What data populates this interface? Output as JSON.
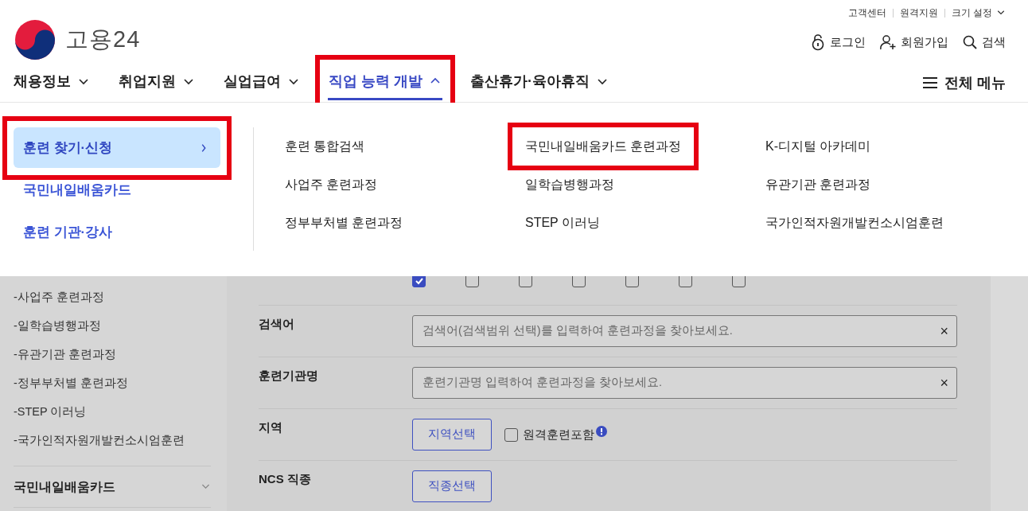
{
  "utility_links": [
    {
      "label": "고객센터",
      "kind": "link"
    },
    {
      "label": "원격지원",
      "kind": "link"
    },
    {
      "label": "크기 설정",
      "kind": "dropdown"
    }
  ],
  "logo": {
    "text": "고용24"
  },
  "account_links": [
    {
      "label": "로그인",
      "kind": "login"
    },
    {
      "label": "회원가입",
      "kind": "signup"
    },
    {
      "label": "검색",
      "kind": "search"
    }
  ],
  "nav": {
    "items": [
      {
        "label": "채용정보",
        "selected": false,
        "highlighted": false
      },
      {
        "label": "취업지원",
        "selected": false,
        "highlighted": false
      },
      {
        "label": "실업급여",
        "selected": false,
        "highlighted": false
      },
      {
        "label": "직업 능력 개발",
        "selected": true,
        "highlighted": true
      },
      {
        "label": "출산휴가·육아휴직",
        "selected": false,
        "highlighted": false
      }
    ],
    "all_menu": "전체 메뉴"
  },
  "mega_menu": {
    "sidebar": [
      {
        "label": "훈련 찾기·신청",
        "selected": true,
        "highlighted": true
      },
      {
        "label": "국민내일배움카드",
        "selected": false,
        "highlighted": false
      },
      {
        "label": "훈련 기관·강사",
        "selected": false,
        "highlighted": false
      }
    ],
    "columns": [
      [
        {
          "label": "훈련 통합검색",
          "highlighted": false
        },
        {
          "label": "사업주 훈련과정",
          "highlighted": false
        },
        {
          "label": "정부부처별 훈련과정",
          "highlighted": false
        }
      ],
      [
        {
          "label": "국민내일배움카드 훈련과정",
          "highlighted": true
        },
        {
          "label": "일학습병행과정",
          "highlighted": false
        },
        {
          "label": "STEP 이러닝",
          "highlighted": false
        }
      ],
      [
        {
          "label": "K-디지털 아카데미",
          "highlighted": false
        },
        {
          "label": "유관기관 훈련과정",
          "highlighted": false
        },
        {
          "label": "국가인적자원개발컨소시엄훈련",
          "highlighted": false
        }
      ]
    ]
  },
  "side_list": {
    "items": [
      "-사업주 훈련과정",
      "-일학습병행과정",
      "-유관기관 훈련과정",
      "-정부부처별 훈련과정",
      "-STEP 이러닝",
      "-국가인적자원개발컨소시엄훈련"
    ],
    "section": {
      "label": "국민내일배움카드",
      "expanded": false
    }
  },
  "search_form": {
    "scope_checkboxes": [
      {
        "checked": true
      },
      {
        "checked": false
      },
      {
        "checked": false
      },
      {
        "checked": false
      },
      {
        "checked": false
      },
      {
        "checked": false
      },
      {
        "checked": false
      }
    ],
    "rows": [
      {
        "label": "검색어",
        "kind": "text",
        "placeholder": "검색어(검색범위 선택)를 입력하여 훈련과정을 찾아보세요.",
        "clear": "×"
      },
      {
        "label": "훈련기관명",
        "kind": "text",
        "placeholder": "훈련기관명 입력하여 훈련과정을 찾아보세요.",
        "clear": "×"
      },
      {
        "label": "지역",
        "kind": "button",
        "button": "지역선택",
        "option": {
          "label": "원격훈련포함",
          "checked": false
        }
      },
      {
        "label": "NCS 직종",
        "kind": "button",
        "button": "직종선택"
      }
    ]
  }
}
